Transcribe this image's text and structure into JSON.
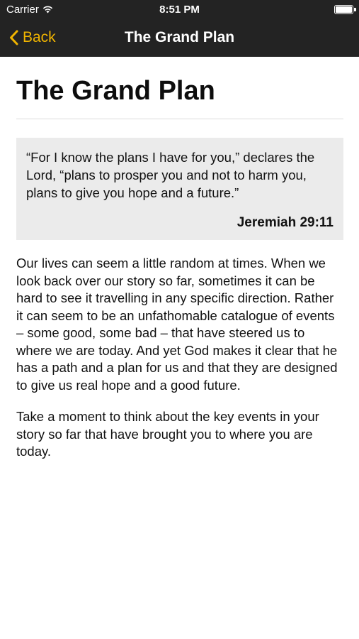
{
  "status_bar": {
    "carrier": "Carrier",
    "time": "8:51 PM",
    "battery_level": 1.0
  },
  "nav": {
    "back_label": "Back",
    "title": "The Grand Plan",
    "accent_color": "#f0b400",
    "bar_color": "#232323"
  },
  "article": {
    "heading": "The Grand Plan",
    "quote": {
      "text": "“For I know the plans I have for you,” declares the Lord, “plans to prosper you and not to harm you, plans to give you hope and a future.”",
      "reference": "Jeremiah 29:11"
    },
    "paragraphs": [
      "Our lives can seem a little random at times. When we look back over our story so far, sometimes it can be hard to see it travelling in any specific direction. Rather it can seem to be an unfathomable catalogue of events – some good, some bad – that have steered us to where we are today. And yet God makes it clear that he has a path and a plan for us and that they are designed to give us real hope and a good future.",
      "Take a moment to think about the key events in your story so far that have brought you to where you are today."
    ]
  }
}
